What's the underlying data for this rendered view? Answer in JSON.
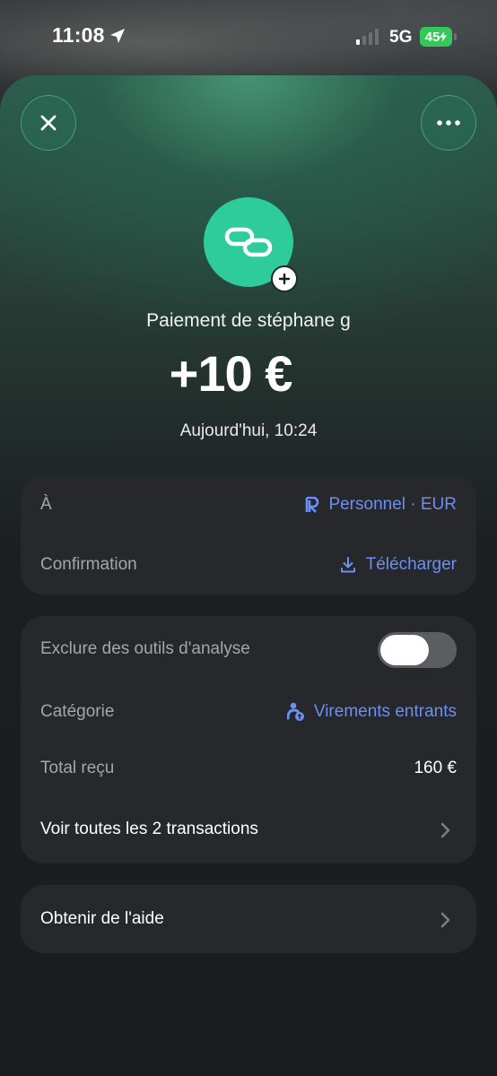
{
  "status_bar": {
    "time": "11:08",
    "network": "5G",
    "battery": "45"
  },
  "header": {
    "close_icon": "close-icon",
    "more_icon": "more-icon"
  },
  "transaction": {
    "title": "Paiement de stéphane g",
    "amount": "+10 €",
    "date": "Aujourd'hui, 10:24",
    "accent_color": "#2ecc9a"
  },
  "details": {
    "to_label": "À",
    "to_value": "Personnel · EUR",
    "confirmation_label": "Confirmation",
    "download_label": "Télécharger"
  },
  "analytics": {
    "exclude_label": "Exclure des outils d'analyse",
    "exclude_enabled": false,
    "category_label": "Catégorie",
    "category_value": "Virements entrants",
    "total_label": "Total reçu",
    "total_value": "160 €",
    "view_all_label": "Voir toutes les 2 transactions"
  },
  "help": {
    "label": "Obtenir de l'aide"
  },
  "colors": {
    "link": "#6b8ff5",
    "card": "#26282b",
    "muted_text": "#a3a6aa"
  }
}
